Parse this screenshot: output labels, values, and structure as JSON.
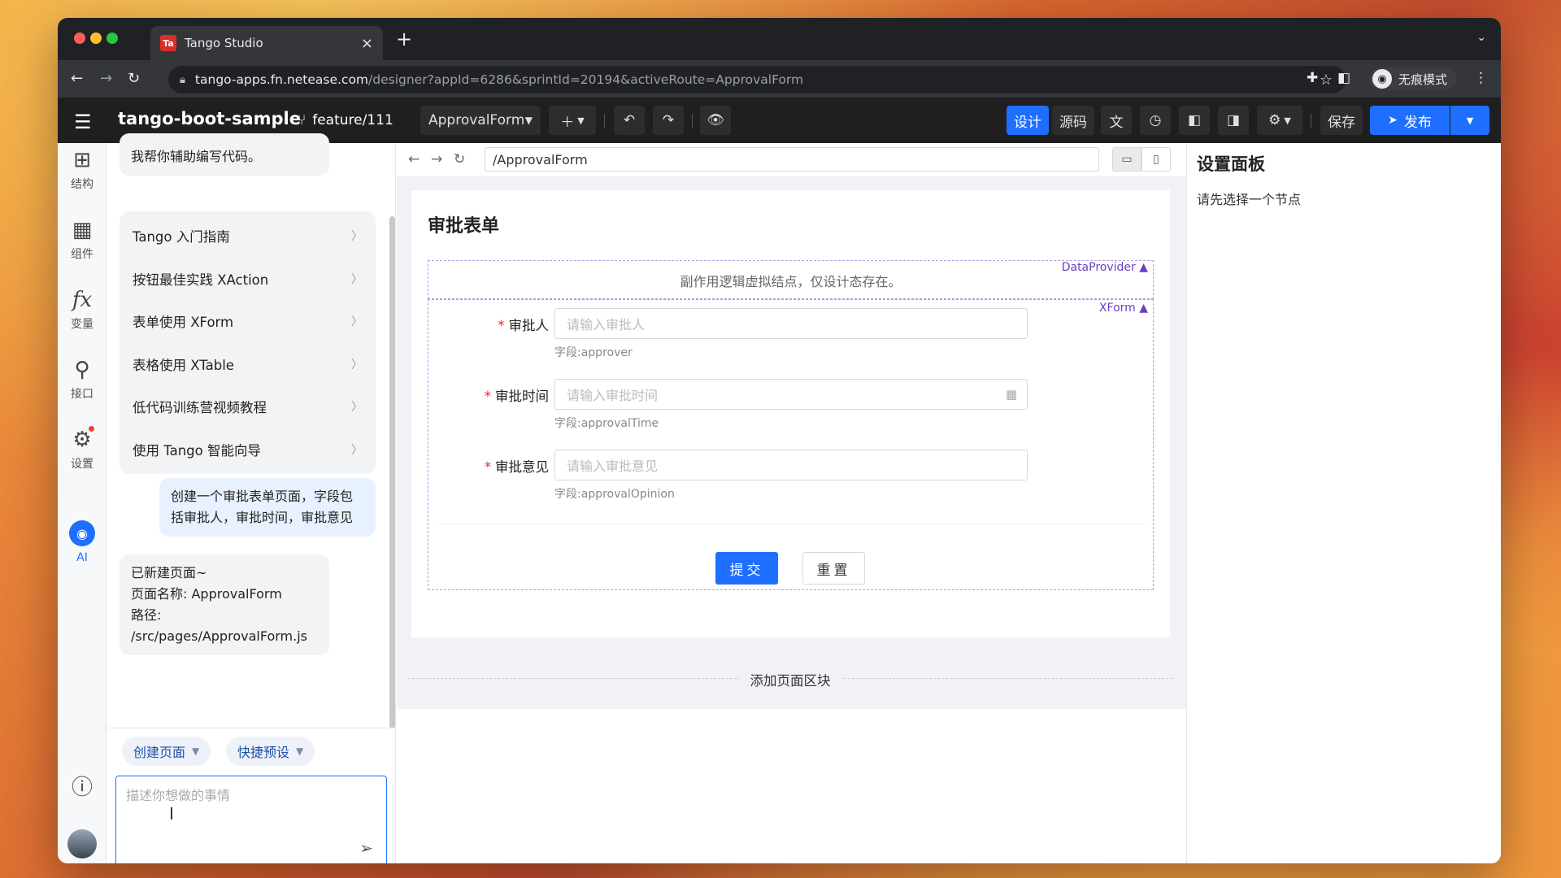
{
  "browser": {
    "tab_title": "Tango Studio",
    "tab_favicon": "Ta",
    "url_host": "tango-apps.fn.netease.com",
    "url_path": "/designer?appId=6286&sprintId=20194&activeRoute=ApprovalForm",
    "incognito_label": "无痕模式"
  },
  "toolbar": {
    "app_name": "tango-boot-sample",
    "branch": "feature/111",
    "page_select": "ApprovalForm",
    "design_label": "设计",
    "source_label": "源码",
    "save_label": "保存",
    "publish_label": "发布"
  },
  "rail": {
    "items": [
      {
        "label": "结构",
        "icon": "structure-icon"
      },
      {
        "label": "组件",
        "icon": "components-icon"
      },
      {
        "label": "变量",
        "icon": "variable-fx-icon"
      },
      {
        "label": "接口",
        "icon": "api-icon"
      },
      {
        "label": "设置",
        "icon": "settings-icon"
      },
      {
        "label": "AI",
        "icon": "ai-icon"
      }
    ]
  },
  "chat": {
    "intro_tail": "我帮你辅助编写代码。",
    "menu": [
      "Tango 入门指南",
      "按钮最佳实践 XAction",
      "表单使用 XForm",
      "表格使用 XTable",
      "低代码训练营视频教程",
      "使用 Tango 智能向导"
    ],
    "user_message": "创建一个审批表单页面，字段包括审批人，审批时间，审批意见",
    "reply_line1": "已新建页面~",
    "reply_line2": "页面名称: ApprovalForm",
    "reply_line3": "路径:",
    "reply_line4": "/src/pages/ApprovalForm.js",
    "chip_create": "创建页面",
    "chip_preset": "快捷预设",
    "input_placeholder": "描述你想做的事情"
  },
  "canvas": {
    "route": "/ApprovalForm",
    "page_title": "审批表单",
    "dataprovider_tag": "DataProvider",
    "dataprovider_text": "副作用逻辑虚拟结点，仅设计态存在。",
    "xform_tag": "XForm",
    "fields": [
      {
        "label": "审批人",
        "placeholder": "请输入审批人",
        "hint": "字段:approver"
      },
      {
        "label": "审批时间",
        "placeholder": "请输入审批时间",
        "hint": "字段:approvalTime"
      },
      {
        "label": "审批意见",
        "placeholder": "请输入审批意见",
        "hint": "字段:approvalOpinion"
      }
    ],
    "submit_label": "提交",
    "reset_label": "重置",
    "add_block_label": "添加页面区块"
  },
  "settings": {
    "title": "设置面板",
    "empty_text": "请先选择一个节点"
  },
  "colors": {
    "accent": "#1e6fff",
    "required": "#f5222d",
    "tag": "#6a3fbf"
  }
}
